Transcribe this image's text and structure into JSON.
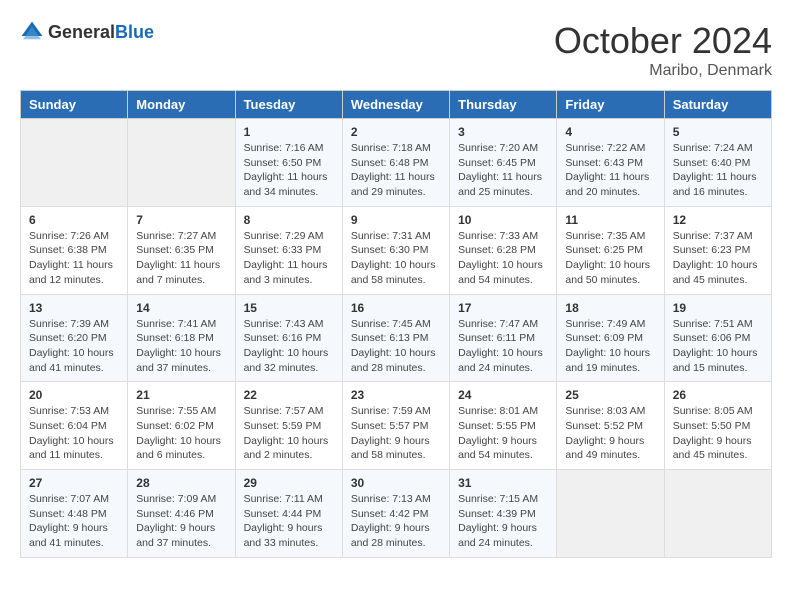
{
  "header": {
    "logo_general": "General",
    "logo_blue": "Blue",
    "month": "October 2024",
    "location": "Maribo, Denmark"
  },
  "days_of_week": [
    "Sunday",
    "Monday",
    "Tuesday",
    "Wednesday",
    "Thursday",
    "Friday",
    "Saturday"
  ],
  "weeks": [
    [
      {
        "day": "",
        "info": ""
      },
      {
        "day": "",
        "info": ""
      },
      {
        "day": "1",
        "info": "Sunrise: 7:16 AM\nSunset: 6:50 PM\nDaylight: 11 hours and 34 minutes."
      },
      {
        "day": "2",
        "info": "Sunrise: 7:18 AM\nSunset: 6:48 PM\nDaylight: 11 hours and 29 minutes."
      },
      {
        "day": "3",
        "info": "Sunrise: 7:20 AM\nSunset: 6:45 PM\nDaylight: 11 hours and 25 minutes."
      },
      {
        "day": "4",
        "info": "Sunrise: 7:22 AM\nSunset: 6:43 PM\nDaylight: 11 hours and 20 minutes."
      },
      {
        "day": "5",
        "info": "Sunrise: 7:24 AM\nSunset: 6:40 PM\nDaylight: 11 hours and 16 minutes."
      }
    ],
    [
      {
        "day": "6",
        "info": "Sunrise: 7:26 AM\nSunset: 6:38 PM\nDaylight: 11 hours and 12 minutes."
      },
      {
        "day": "7",
        "info": "Sunrise: 7:27 AM\nSunset: 6:35 PM\nDaylight: 11 hours and 7 minutes."
      },
      {
        "day": "8",
        "info": "Sunrise: 7:29 AM\nSunset: 6:33 PM\nDaylight: 11 hours and 3 minutes."
      },
      {
        "day": "9",
        "info": "Sunrise: 7:31 AM\nSunset: 6:30 PM\nDaylight: 10 hours and 58 minutes."
      },
      {
        "day": "10",
        "info": "Sunrise: 7:33 AM\nSunset: 6:28 PM\nDaylight: 10 hours and 54 minutes."
      },
      {
        "day": "11",
        "info": "Sunrise: 7:35 AM\nSunset: 6:25 PM\nDaylight: 10 hours and 50 minutes."
      },
      {
        "day": "12",
        "info": "Sunrise: 7:37 AM\nSunset: 6:23 PM\nDaylight: 10 hours and 45 minutes."
      }
    ],
    [
      {
        "day": "13",
        "info": "Sunrise: 7:39 AM\nSunset: 6:20 PM\nDaylight: 10 hours and 41 minutes."
      },
      {
        "day": "14",
        "info": "Sunrise: 7:41 AM\nSunset: 6:18 PM\nDaylight: 10 hours and 37 minutes."
      },
      {
        "day": "15",
        "info": "Sunrise: 7:43 AM\nSunset: 6:16 PM\nDaylight: 10 hours and 32 minutes."
      },
      {
        "day": "16",
        "info": "Sunrise: 7:45 AM\nSunset: 6:13 PM\nDaylight: 10 hours and 28 minutes."
      },
      {
        "day": "17",
        "info": "Sunrise: 7:47 AM\nSunset: 6:11 PM\nDaylight: 10 hours and 24 minutes."
      },
      {
        "day": "18",
        "info": "Sunrise: 7:49 AM\nSunset: 6:09 PM\nDaylight: 10 hours and 19 minutes."
      },
      {
        "day": "19",
        "info": "Sunrise: 7:51 AM\nSunset: 6:06 PM\nDaylight: 10 hours and 15 minutes."
      }
    ],
    [
      {
        "day": "20",
        "info": "Sunrise: 7:53 AM\nSunset: 6:04 PM\nDaylight: 10 hours and 11 minutes."
      },
      {
        "day": "21",
        "info": "Sunrise: 7:55 AM\nSunset: 6:02 PM\nDaylight: 10 hours and 6 minutes."
      },
      {
        "day": "22",
        "info": "Sunrise: 7:57 AM\nSunset: 5:59 PM\nDaylight: 10 hours and 2 minutes."
      },
      {
        "day": "23",
        "info": "Sunrise: 7:59 AM\nSunset: 5:57 PM\nDaylight: 9 hours and 58 minutes."
      },
      {
        "day": "24",
        "info": "Sunrise: 8:01 AM\nSunset: 5:55 PM\nDaylight: 9 hours and 54 minutes."
      },
      {
        "day": "25",
        "info": "Sunrise: 8:03 AM\nSunset: 5:52 PM\nDaylight: 9 hours and 49 minutes."
      },
      {
        "day": "26",
        "info": "Sunrise: 8:05 AM\nSunset: 5:50 PM\nDaylight: 9 hours and 45 minutes."
      }
    ],
    [
      {
        "day": "27",
        "info": "Sunrise: 7:07 AM\nSunset: 4:48 PM\nDaylight: 9 hours and 41 minutes."
      },
      {
        "day": "28",
        "info": "Sunrise: 7:09 AM\nSunset: 4:46 PM\nDaylight: 9 hours and 37 minutes."
      },
      {
        "day": "29",
        "info": "Sunrise: 7:11 AM\nSunset: 4:44 PM\nDaylight: 9 hours and 33 minutes."
      },
      {
        "day": "30",
        "info": "Sunrise: 7:13 AM\nSunset: 4:42 PM\nDaylight: 9 hours and 28 minutes."
      },
      {
        "day": "31",
        "info": "Sunrise: 7:15 AM\nSunset: 4:39 PM\nDaylight: 9 hours and 24 minutes."
      },
      {
        "day": "",
        "info": ""
      },
      {
        "day": "",
        "info": ""
      }
    ]
  ]
}
